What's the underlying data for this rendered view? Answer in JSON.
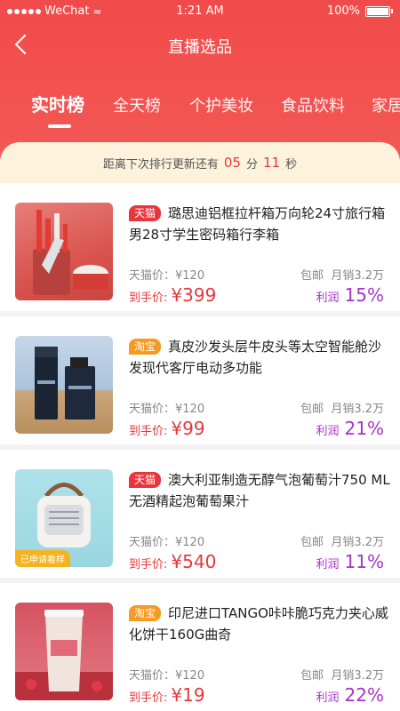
{
  "status": {
    "carrier": "WeChat",
    "time": "1:21 AM",
    "battery": "100%"
  },
  "nav": {
    "title": "直播选品"
  },
  "tabs": [
    "实时榜",
    "全天榜",
    "个护美妆",
    "食品饮料",
    "家居"
  ],
  "countdown": {
    "prefix": "距离下次排行更新还有",
    "minutes": "05",
    "min_unit": "分",
    "seconds": "11",
    "sec_unit": "秒"
  },
  "colors": {
    "header": "#f14a4a",
    "price": "#e8373c",
    "profit": "#a633c9",
    "tmall": "#e8373c",
    "taobao": "#f59a22",
    "applied": "#f6b320"
  },
  "products": [
    {
      "store": "天猫",
      "store_type": "tmall",
      "title": "璐思迪铝框拉杆箱万向轮24寸旅行箱男28寸学生密码箱行李箱",
      "orig_label": "天猫价：",
      "orig_price": "¥120",
      "ship": "包邮",
      "sales": "月销3.2万",
      "final_label": "到手价:",
      "final_price": "¥399",
      "profit_label": "利润",
      "profit": "15%",
      "image": "knife-set-image",
      "applied": ""
    },
    {
      "store": "淘宝",
      "store_type": "taobao",
      "title": "真皮沙发头层牛皮头等太空智能舱沙发现代客厅电动多功能",
      "orig_label": "天猫价：",
      "orig_price": "¥120",
      "ship": "包邮",
      "sales": "月销3.2万",
      "final_label": "到手价:",
      "final_price": "¥99",
      "profit_label": "利润",
      "profit": "21%",
      "image": "dior-sauvage-image",
      "applied": ""
    },
    {
      "store": "天猫",
      "store_type": "tmall",
      "title": "澳大利亚制造无醇气泡葡萄汁750 ML 无酒精起泡葡萄果汁",
      "orig_label": "天猫价：",
      "orig_price": "¥120",
      "ship": "包邮",
      "sales": "月销3.2万",
      "final_label": "到手价:",
      "final_price": "¥540",
      "profit_label": "利润",
      "profit": "11%",
      "image": "desk-fan-image",
      "applied": "已申请看样"
    },
    {
      "store": "淘宝",
      "store_type": "taobao",
      "title": "印尼进口TANGO咔咔脆巧克力夹心威化饼干160G曲奇",
      "orig_label": "天猫价：",
      "orig_price": "¥120",
      "ship": "包邮",
      "sales": "月销3.2万",
      "final_label": "到手价:",
      "final_price": "¥19",
      "profit_label": "利润",
      "profit": "22%",
      "image": "milk-tea-image",
      "applied": ""
    }
  ]
}
